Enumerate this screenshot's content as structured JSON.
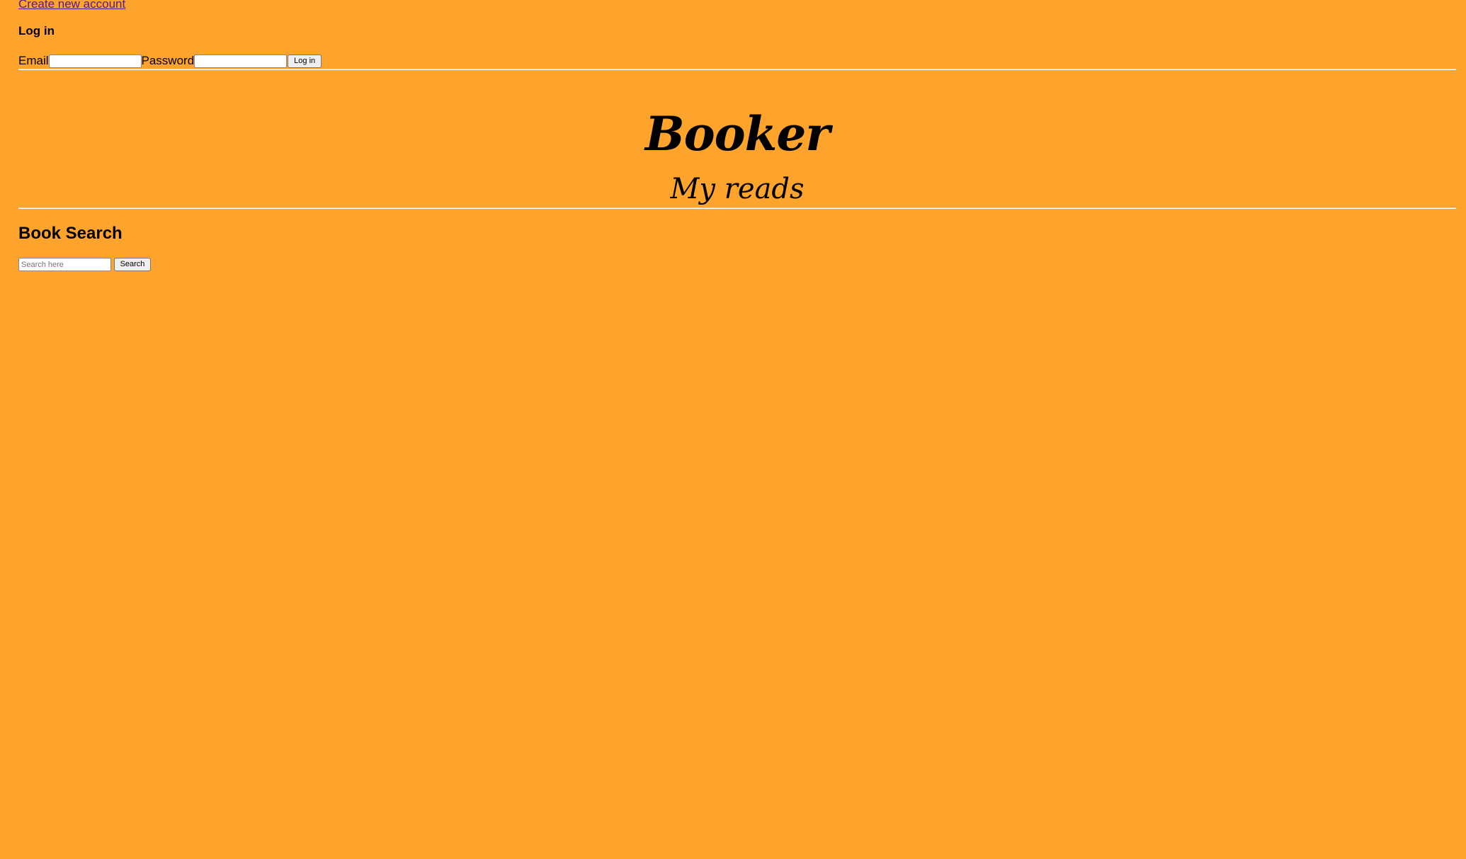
{
  "nav": {
    "create_account_link": "Create new account"
  },
  "login": {
    "heading": "Log in",
    "email_label": "Email",
    "email_value": "",
    "password_label": "Password",
    "password_value": "",
    "submit_label": "Log in"
  },
  "hero": {
    "title": "Booker",
    "subtitle": "My reads"
  },
  "search": {
    "heading": "Book Search",
    "placeholder": "Search here",
    "value": "",
    "button_label": "Search"
  },
  "colors": {
    "background": "#fea32c",
    "link": "#551a8b"
  }
}
